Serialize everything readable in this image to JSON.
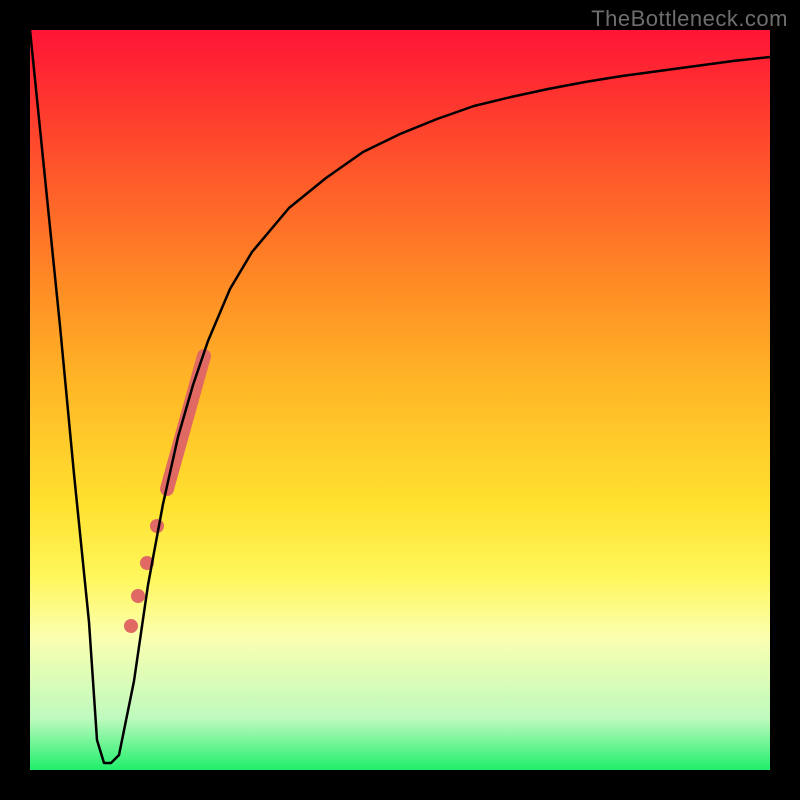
{
  "branding": {
    "watermark": "TheBottleneck.com"
  },
  "chart_data": {
    "type": "line",
    "title": "",
    "xlabel": "",
    "ylabel": "",
    "xlim": [
      0,
      100
    ],
    "ylim": [
      0,
      100
    ],
    "grid": false,
    "legend": false,
    "background": "traffic-light vertical gradient (red top → green bottom)",
    "series": [
      {
        "name": "bottleneck-curve",
        "type": "line",
        "color": "#000000",
        "x": [
          0,
          2,
          4,
          6,
          8,
          9,
          10,
          11,
          12,
          14,
          16,
          18,
          20,
          22,
          24,
          27,
          30,
          35,
          40,
          45,
          50,
          55,
          60,
          65,
          70,
          75,
          80,
          85,
          90,
          95,
          100
        ],
        "y": [
          100,
          80,
          60,
          40,
          20,
          4,
          1,
          1,
          2,
          12,
          25,
          36,
          45,
          52,
          58,
          65,
          70,
          76,
          80,
          83.5,
          86,
          88,
          89.7,
          91,
          92,
          93,
          93.8,
          94.5,
          95.2,
          95.8,
          96.3
        ]
      },
      {
        "name": "highlight-segment",
        "type": "line",
        "color": "#e06963",
        "stroke_width_px": 14,
        "x": [
          18.5,
          23.5
        ],
        "y": [
          38,
          56
        ]
      },
      {
        "name": "highlight-dots",
        "type": "scatter",
        "color": "#e06963",
        "marker_radius_px": 7,
        "x": [
          17.2,
          15.8,
          14.6,
          13.6
        ],
        "y": [
          33,
          28,
          23.5,
          19.5
        ]
      }
    ]
  }
}
